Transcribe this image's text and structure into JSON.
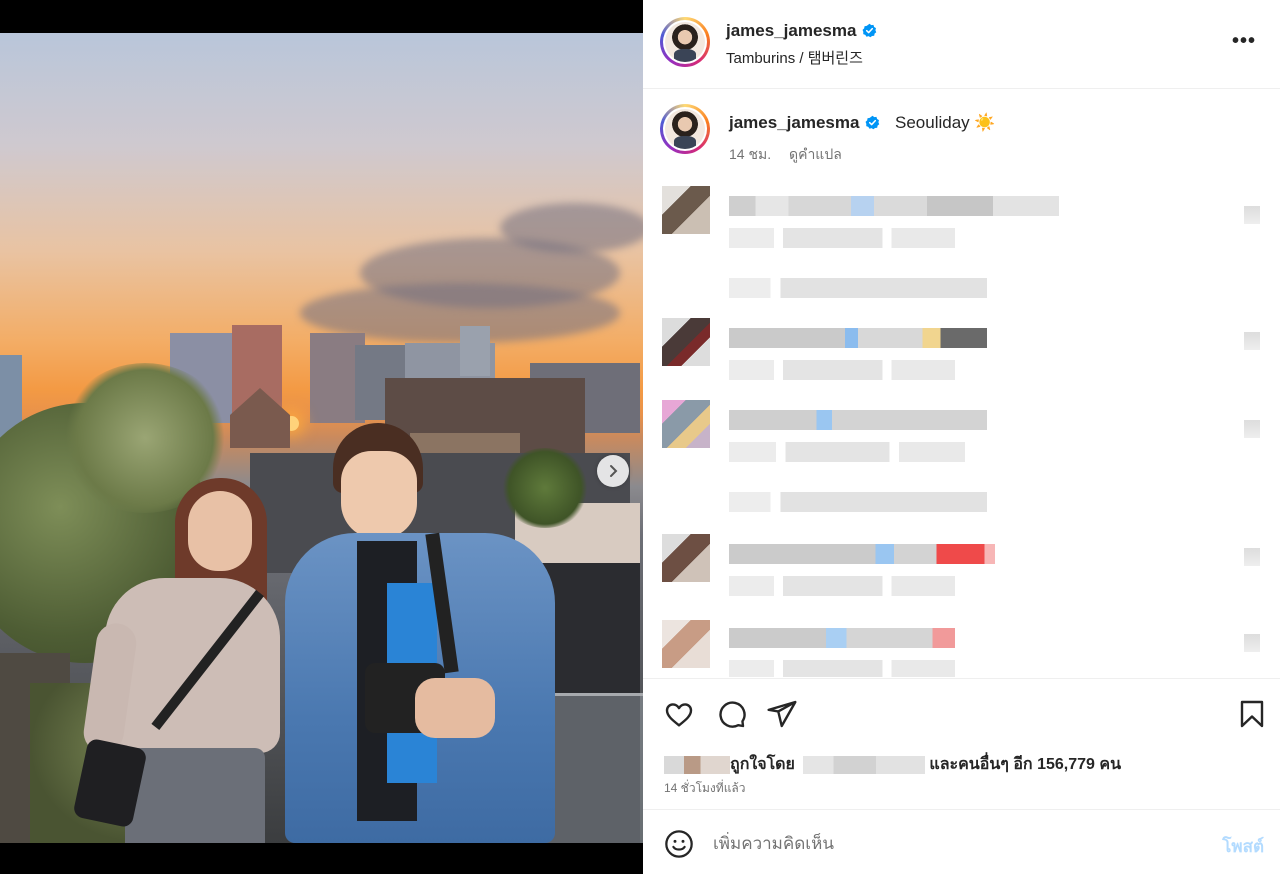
{
  "header": {
    "username": "james_jamesma",
    "location": "Tamburins / 탬버린즈",
    "more_icon": "more-horizontal-icon",
    "more_label": "•••"
  },
  "caption": {
    "username": "james_jamesma",
    "text": "Seouliday ☀️",
    "time": "14 ชม.",
    "translate": "ดูคำแปล"
  },
  "comments": {
    "count_visible": 6,
    "content": "blurred"
  },
  "actions": {
    "like_icon": "heart-icon",
    "comment_icon": "comment-icon",
    "share_icon": "send-icon",
    "save_icon": "bookmark-icon"
  },
  "likes": {
    "prefix": "ถูกใจโดย",
    "middle": "และคนอื่นๆ อีก",
    "count": "156,779",
    "suffix": "คน"
  },
  "time_ago": "14 ชั่วโมงที่แล้ว",
  "add_comment": {
    "placeholder": "เพิ่มความคิดเห็น",
    "post_label": "โพสต์",
    "emoji_icon": "emoji-icon"
  },
  "carousel": {
    "slides": 2,
    "active": 1,
    "next_icon": "chevron-right-icon"
  },
  "colors": {
    "verified": "#0095f6",
    "post_disabled": "#b3dbff",
    "meta": "#737373"
  }
}
